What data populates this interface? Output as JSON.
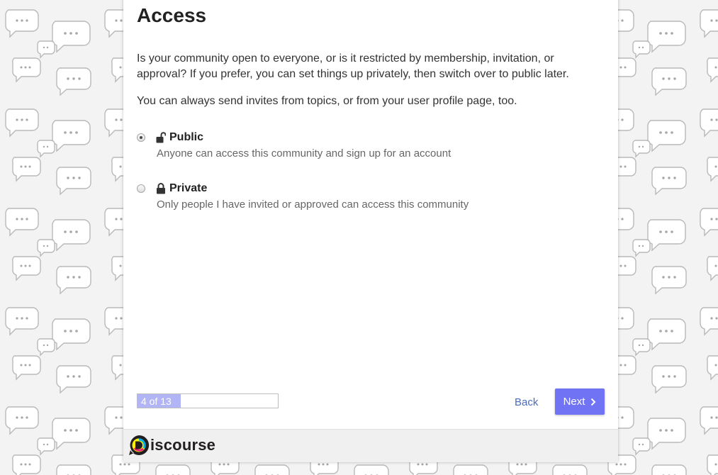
{
  "step": {
    "title": "Access",
    "description_1": "Is your community open to everyone, or is it restricted by membership, invitation, or approval? If you prefer, you can set things up privately, then switch over to public later.",
    "description_2": "You can always send invites from topics, or from your user profile page, too."
  },
  "options": [
    {
      "id": "public",
      "title": "Public",
      "description": "Anyone can access this community and sign up for an account",
      "selected": true,
      "icon": "unlock-icon"
    },
    {
      "id": "private",
      "title": "Private",
      "description": "Only people I have invited or approved can access this community",
      "selected": false,
      "icon": "lock-icon"
    }
  ],
  "progress": {
    "label": "4 of 13",
    "current": 4,
    "total": 13
  },
  "nav": {
    "back_label": "Back",
    "next_label": "Next"
  },
  "footer": {
    "logo_text": "iscourse"
  },
  "colors": {
    "accent": "#6f73f4",
    "progress_fill": "#b2b5f5",
    "link": "#4a6bbd",
    "footer_bg": "#f0f0f0"
  }
}
